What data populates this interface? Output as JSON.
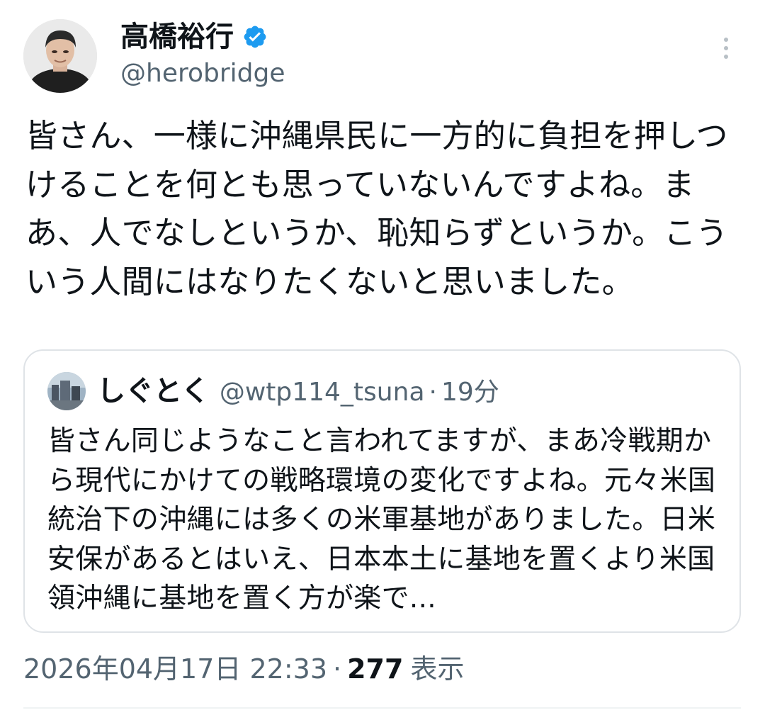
{
  "author": {
    "name": "高橋裕行",
    "handle": "@herobridge",
    "verified": true,
    "avatar_icon": "avatar-icon"
  },
  "tweet": {
    "text": "皆さん、一様に沖縄県民に一方的に負担を押しつけることを何とも思っていないんですよね。まあ、人でなしというか、恥知らずというか。こういう人間にはなりたくないと思いました。"
  },
  "quote": {
    "name": "しぐとく",
    "handle": "@wtp114_tsuna",
    "dot": "·",
    "time": "19分",
    "text": "皆さん同じようなこと言われてますが、まあ冷戦期から現代にかけての戦略環境の変化ですよね。元々米国統治下の沖縄には多くの米軍基地がありました。日米安保があるとはいえ、日本本土に基地を置くより米国領沖縄に基地を置く方が楽で..."
  },
  "meta": {
    "timestamp": "2026年04月17日 22:33",
    "separator": "·",
    "views_count": "277",
    "views_label": "表示"
  },
  "colors": {
    "verified": "#1d9bf0",
    "secondary_text": "#536471",
    "border": "#dfe3e7"
  }
}
